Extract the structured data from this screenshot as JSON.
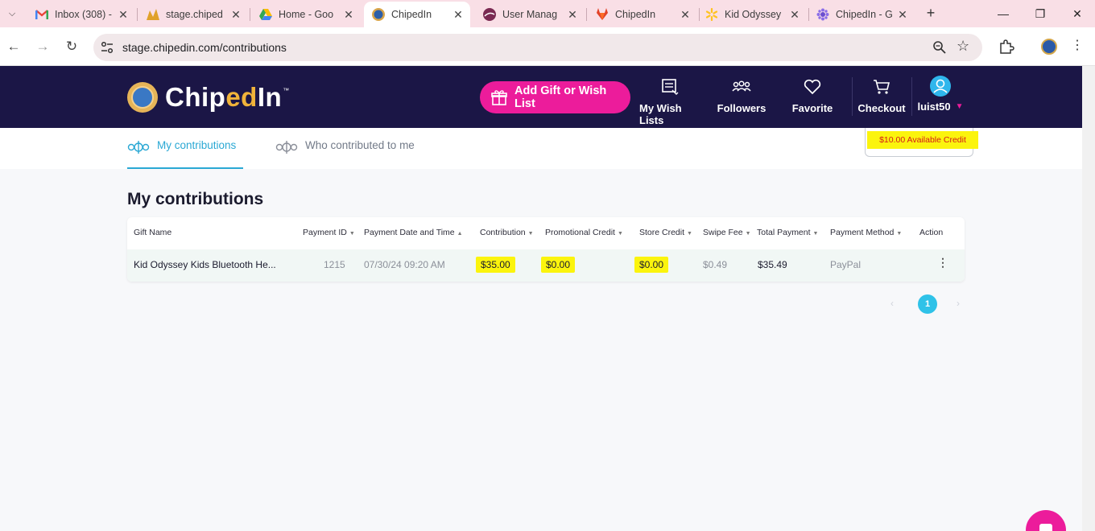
{
  "browser": {
    "tabs": [
      {
        "title": "Inbox (308) -",
        "icon": "gmail-icon"
      },
      {
        "title": "stage.chiped",
        "icon": "pma-icon"
      },
      {
        "title": "Home - Goo",
        "icon": "google-drive-icon"
      },
      {
        "title": "ChipedIn",
        "icon": "chipedin-icon",
        "active": true
      },
      {
        "title": "User Manag",
        "icon": "user-manage-icon"
      },
      {
        "title": "ChipedIn",
        "icon": "gitlab-icon"
      },
      {
        "title": "Kid Odyssey",
        "icon": "walmart-icon"
      },
      {
        "title": "ChipedIn - G",
        "icon": "gear-flower-icon"
      }
    ],
    "url": "stage.chipedin.com/contributions"
  },
  "header": {
    "logo_pre": "Chip",
    "logo_mid": "ed",
    "logo_post": "In",
    "logo_tm": "™",
    "add_button": "Add Gift or Wish List",
    "nav": {
      "wishlists": "My Wish Lists",
      "followers": "Followers",
      "favorite": "Favorite",
      "checkout": "Checkout",
      "user": "luist50"
    }
  },
  "subnav": {
    "my_contributions": "My contributions",
    "who_contributed": "Who contributed to me",
    "credit": "$10.00 Available Credit"
  },
  "main": {
    "title": "My contributions",
    "columns": {
      "gift_name": "Gift Name",
      "payment_id": "Payment ID",
      "date_time": "Payment Date and Time",
      "contribution": "Contribution",
      "promo_credit": "Promotional Credit",
      "store_credit": "Store Credit",
      "swipe_fee": "Swipe Fee",
      "total_payment": "Total Payment",
      "payment_method": "Payment Method",
      "action": "Action"
    },
    "rows": [
      {
        "gift_name": "Kid Odyssey Kids Bluetooth He...",
        "payment_id": "1215",
        "date_time": "07/30/24 09:20 AM",
        "contribution": "$35.00",
        "promo_credit": "$0.00",
        "store_credit": "$0.00",
        "swipe_fee": "$0.49",
        "total_payment": "$35.49",
        "payment_method": "PayPal"
      }
    ],
    "pagination": {
      "prev": "‹",
      "page": "1",
      "next": "›"
    }
  },
  "colors": {
    "header_bg": "#1b1646",
    "accent_pink": "#ec1c9b",
    "accent_blue": "#2aa8d4",
    "highlight": "#fbf40d"
  }
}
